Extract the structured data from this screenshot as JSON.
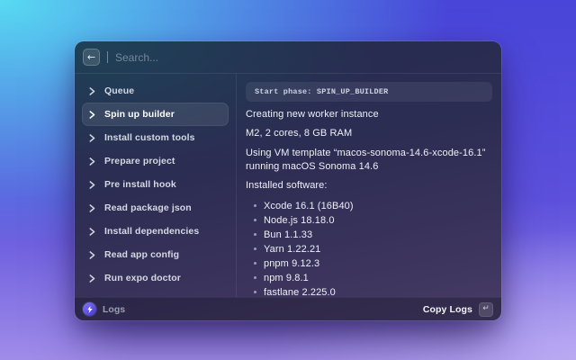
{
  "colors": {
    "bg-cyan": "#58dbf2",
    "bg-indigo": "#4845d8",
    "bg-lavender": "#a08ce8",
    "win-navy": "#242c4e",
    "win-purple": "#473c66",
    "accent-badge-from": "#7e6ff2",
    "accent-badge-to": "#4a3ecf",
    "text-primary": "#eef0f6",
    "text-secondary": "#d3d8e2",
    "text-muted": "#98a0b3"
  },
  "search": {
    "placeholder": "Search...",
    "back_glyph": "←"
  },
  "sidebar": {
    "items": [
      {
        "label": "Queue",
        "selected": false
      },
      {
        "label": "Spin up builder",
        "selected": true
      },
      {
        "label": "Install custom tools",
        "selected": false
      },
      {
        "label": "Prepare project",
        "selected": false
      },
      {
        "label": "Pre install hook",
        "selected": false
      },
      {
        "label": "Read package json",
        "selected": false
      },
      {
        "label": "Install dependencies",
        "selected": false
      },
      {
        "label": "Read app config",
        "selected": false
      },
      {
        "label": "Run expo doctor",
        "selected": false
      }
    ]
  },
  "content": {
    "phase_banner": "Start phase: SPIN_UP_BUILDER",
    "paragraphs": [
      "Creating new worker instance",
      "M2, 2 cores, 8 GB RAM",
      "Using VM template “macos-sonoma-14.6-xcode-16.1” running macOS Sonoma 14.6",
      "Installed software:"
    ],
    "software": [
      "Xcode 16.1 (16B40)",
      "Node.js 18.18.0",
      "Bun 1.1.33",
      "Yarn 1.22.21",
      "pnpm 9.12.3",
      "npm 9.8.1",
      "fastlane 2.225.0"
    ]
  },
  "footer": {
    "label": "Logs",
    "copy_button": "Copy Logs",
    "enter_key_glyph": "↵"
  },
  "icons": {
    "back_button": "arrow-left",
    "sidebar_item": "chevron-right",
    "footer_badge": "logs-bolt",
    "copy_shortcut": "return-key"
  }
}
